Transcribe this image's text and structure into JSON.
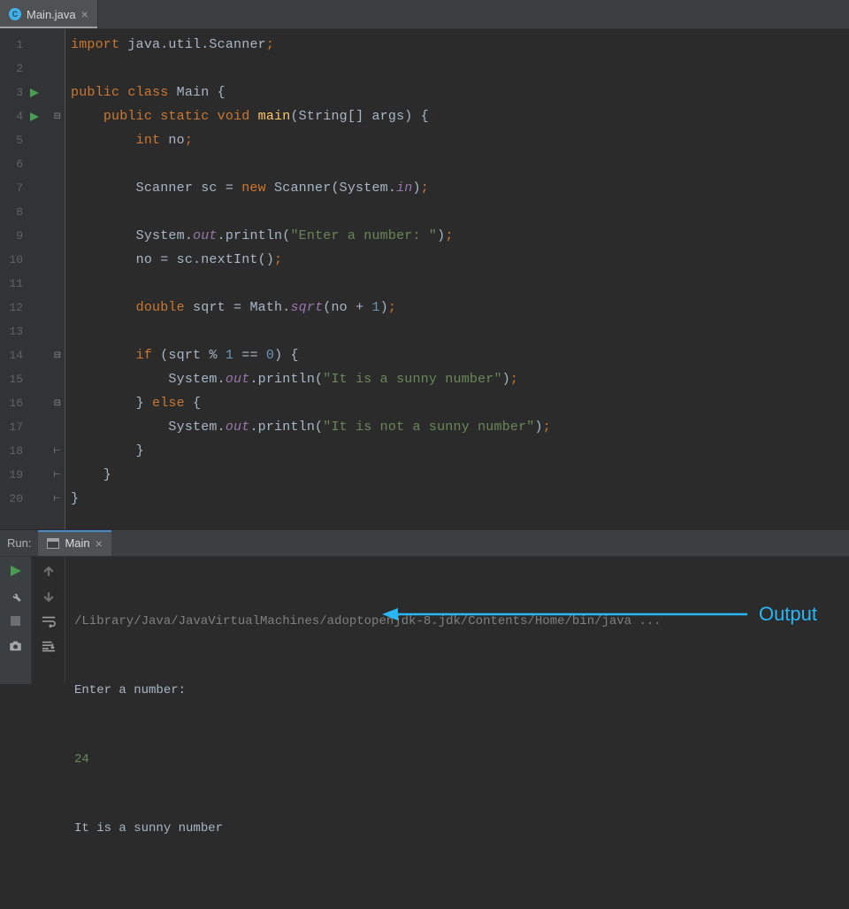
{
  "tab": {
    "filename": "Main.java",
    "file_icon_letter": "C"
  },
  "code": {
    "lines": [
      {
        "n": "1",
        "run": false,
        "fold": "",
        "html": "<span class='kw'>import</span> java.util.Scanner<span class='semi'>;</span>"
      },
      {
        "n": "2",
        "run": false,
        "fold": "",
        "html": ""
      },
      {
        "n": "3",
        "run": true,
        "fold": "",
        "html": "<span class='kw'>public class</span> <span class='cls'>Main</span> {"
      },
      {
        "n": "4",
        "run": true,
        "fold": "⊟",
        "html": "    <span class='kw'>public static void</span> <span class='id'>main</span>(String[] args) {"
      },
      {
        "n": "5",
        "run": false,
        "fold": "",
        "html": "        <span class='kw'>int</span> no<span class='semi'>;</span>"
      },
      {
        "n": "6",
        "run": false,
        "fold": "",
        "html": ""
      },
      {
        "n": "7",
        "run": false,
        "fold": "",
        "html": "        Scanner sc = <span class='kw'>new</span> Scanner(System.<span class='fld'>in</span>)<span class='semi'>;</span>"
      },
      {
        "n": "8",
        "run": false,
        "fold": "",
        "html": ""
      },
      {
        "n": "9",
        "run": false,
        "fold": "",
        "html": "        System.<span class='fld'>out</span>.println(<span class='str'>\"Enter a number: \"</span>)<span class='semi'>;</span>"
      },
      {
        "n": "10",
        "run": false,
        "fold": "",
        "html": "        no = sc.nextInt()<span class='semi'>;</span>"
      },
      {
        "n": "11",
        "run": false,
        "fold": "",
        "html": ""
      },
      {
        "n": "12",
        "run": false,
        "fold": "",
        "html": "        <span class='kw'>double</span> sqrt = Math.<span class='fld'>sqrt</span>(no + <span class='num'>1</span>)<span class='semi'>;</span>"
      },
      {
        "n": "13",
        "run": false,
        "fold": "",
        "html": ""
      },
      {
        "n": "14",
        "run": false,
        "fold": "⊟",
        "html": "        <span class='kw'>if</span> (sqrt % <span class='num'>1</span> == <span class='num'>0</span>) {"
      },
      {
        "n": "15",
        "run": false,
        "fold": "",
        "html": "            System.<span class='fld'>out</span>.println(<span class='str'>\"It is a sunny number\"</span>)<span class='semi'>;</span>"
      },
      {
        "n": "16",
        "run": false,
        "fold": "⊟",
        "html": "        } <span class='kw'>else</span> {"
      },
      {
        "n": "17",
        "run": false,
        "fold": "",
        "html": "            System.<span class='fld'>out</span>.println(<span class='str'>\"It is not a sunny number\"</span>)<span class='semi'>;</span>"
      },
      {
        "n": "18",
        "run": false,
        "fold": "⊢",
        "html": "        }"
      },
      {
        "n": "19",
        "run": false,
        "fold": "⊢",
        "html": "    }"
      },
      {
        "n": "20",
        "run": false,
        "fold": "⊢",
        "html": "}"
      }
    ]
  },
  "run": {
    "label": "Run:",
    "tab_name": "Main",
    "cmd": "/Library/Java/JavaVirtualMachines/adoptopenjdk-8.jdk/Contents/Home/bin/java ...",
    "prompt": "Enter a number:",
    "user_input": "24",
    "result": "It is a sunny number"
  },
  "annotation": {
    "label": "Output"
  }
}
